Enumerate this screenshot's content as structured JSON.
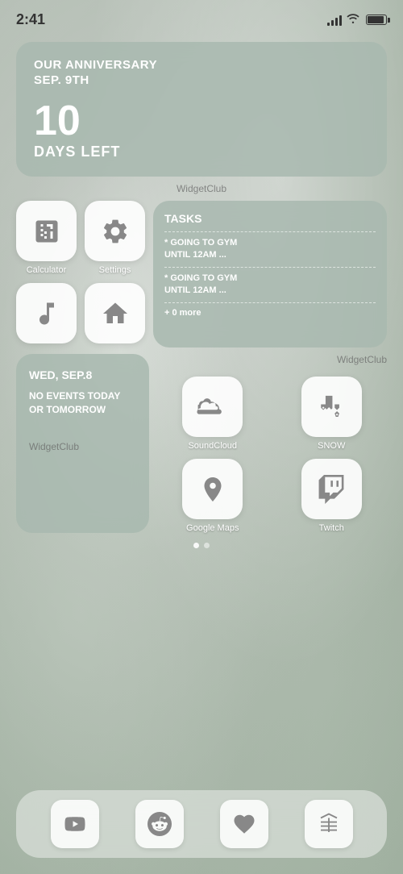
{
  "statusBar": {
    "time": "2:41",
    "signalBars": [
      4,
      7,
      10,
      13,
      16
    ],
    "battery": 85
  },
  "anniversaryWidget": {
    "title": "Our anniversary",
    "date": "Sep. 9th",
    "daysNumber": "10",
    "daysLabel": "Days Left",
    "widgetCredit": "WidgetClub"
  },
  "apps": {
    "calculator": {
      "label": "Calculator"
    },
    "settings": {
      "label": "Settings"
    },
    "music": {
      "label": ""
    },
    "library": {
      "label": ""
    }
  },
  "tasksWidget": {
    "title": "Tasks",
    "items": [
      "* Going to Gym Until 12am ...",
      "* Going to Gym Until 12am ..."
    ],
    "more": "+ 0 more",
    "widgetCredit": "WidgetClub"
  },
  "calendarWidget": {
    "day": "Wed, Sep.8",
    "desc": "No events today or tomorrow",
    "widgetCredit": "WidgetClub"
  },
  "bottomApps": {
    "soundcloud": {
      "label": "SoundCloud"
    },
    "snow": {
      "label": "SNOW"
    },
    "googlemaps": {
      "label": "Google Maps"
    },
    "twitch": {
      "label": "Twitch"
    }
  },
  "dock": {
    "youtube": {},
    "reddit": {},
    "health": {},
    "appstore": {}
  },
  "pageIndicator": {
    "activeDot": 0,
    "totalDots": 2
  }
}
